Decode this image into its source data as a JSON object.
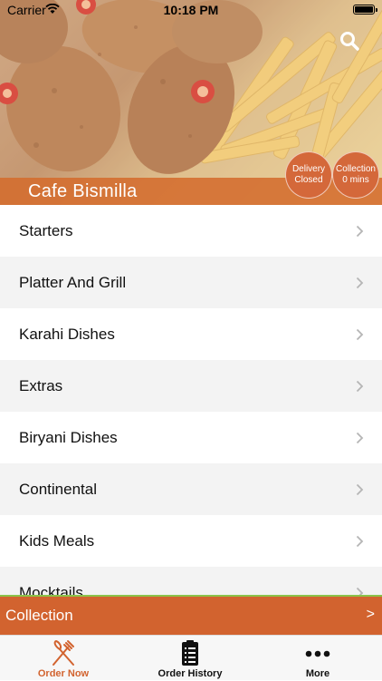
{
  "status_bar": {
    "carrier": "Carrier",
    "time": "10:18 PM"
  },
  "restaurant": {
    "name": "Cafe Bismilla",
    "delivery_badge": {
      "line1": "Delivery",
      "line2": "Closed"
    },
    "collection_badge": {
      "line1": "Collection",
      "line2": "0 mins"
    }
  },
  "menu": {
    "items": [
      {
        "label": "Starters"
      },
      {
        "label": "Platter And Grill"
      },
      {
        "label": "Karahi Dishes"
      },
      {
        "label": "Extras"
      },
      {
        "label": "Biryani Dishes"
      },
      {
        "label": "Continental"
      },
      {
        "label": "Kids Meals"
      },
      {
        "label": "Mocktails"
      }
    ]
  },
  "collection_bar": {
    "label": "Collection",
    "arrow": ">"
  },
  "tabbar": {
    "tabs": [
      {
        "label": "Order Now",
        "icon": "fork-knife-icon",
        "active": true
      },
      {
        "label": "Order History",
        "icon": "receipt-icon",
        "active": false
      },
      {
        "label": "More",
        "icon": "ellipsis-icon",
        "active": false
      }
    ]
  },
  "colors": {
    "accent": "#d2632f",
    "badge": "#d4683a",
    "collection_bar_border": "#8bc34a",
    "row_alt": "#f3f3f3"
  }
}
